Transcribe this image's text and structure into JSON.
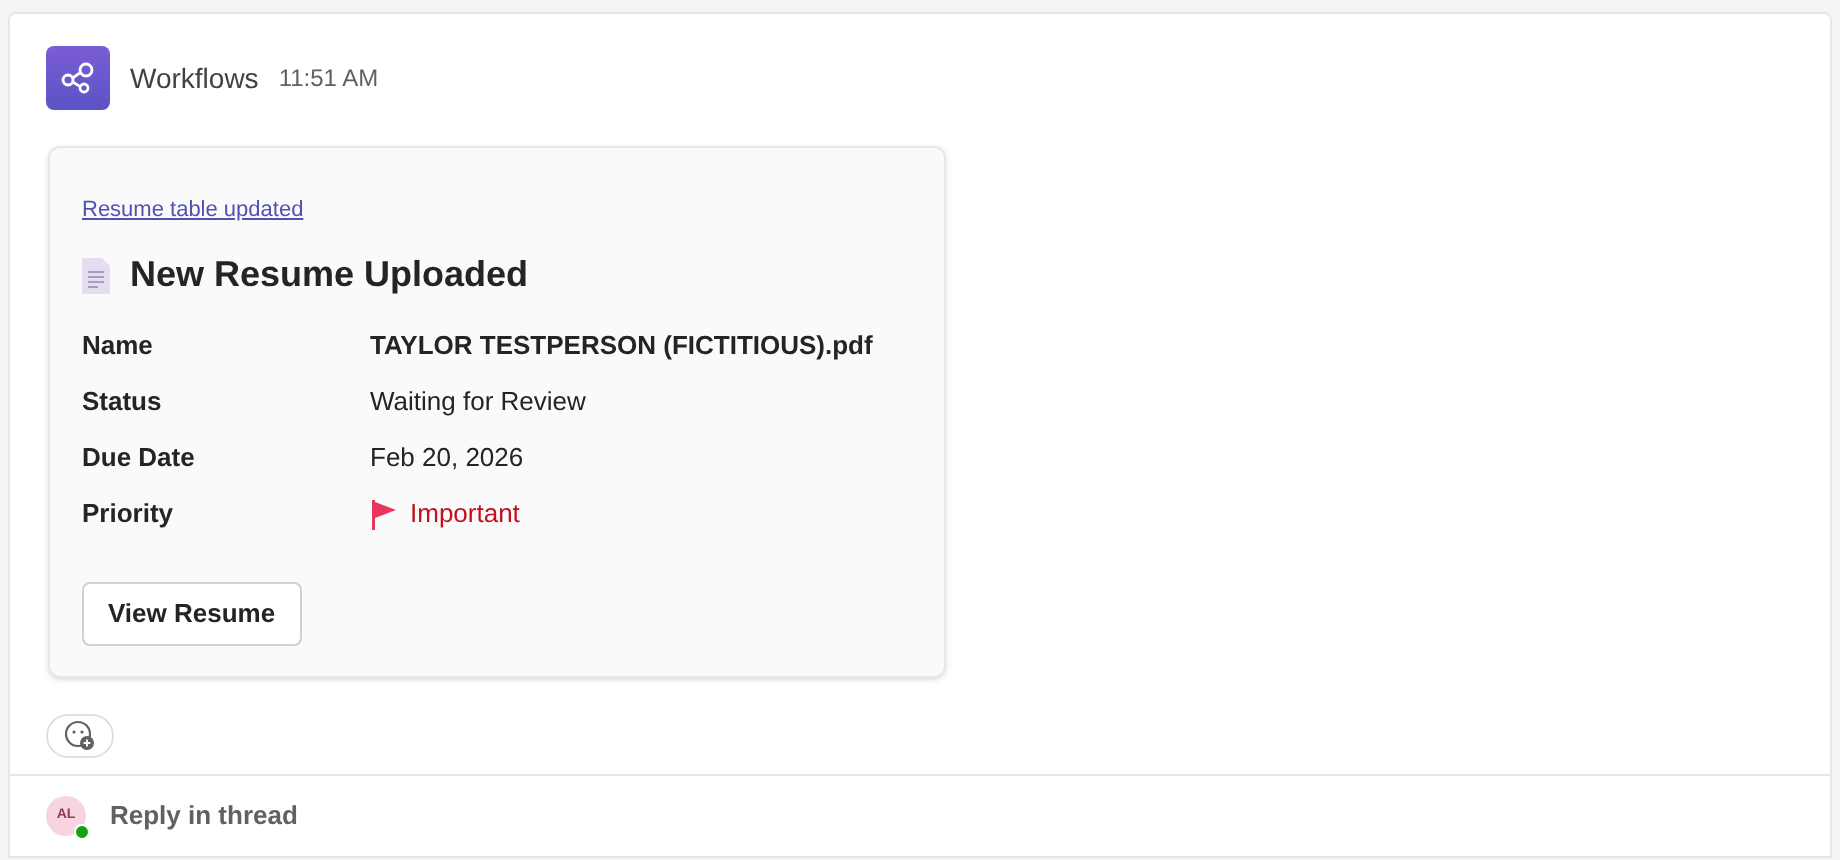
{
  "message": {
    "sender": "Workflows",
    "time": "11:51 AM"
  },
  "card": {
    "link": "Resume table updated",
    "title": "New Resume Uploaded",
    "facts": [
      {
        "label": "Name",
        "value": "TAYLOR TESTPERSON (FICTITIOUS).pdf",
        "kind": "bold"
      },
      {
        "label": "Status",
        "value": "Waiting for Review",
        "kind": "plain"
      },
      {
        "label": "Due Date",
        "value": "Feb 20, 2026",
        "kind": "plain"
      },
      {
        "label": "Priority",
        "value": "Important",
        "kind": "flag"
      }
    ],
    "button": "View Resume"
  },
  "reply": {
    "initials": "AL",
    "online": true,
    "label": "Reply in thread"
  }
}
